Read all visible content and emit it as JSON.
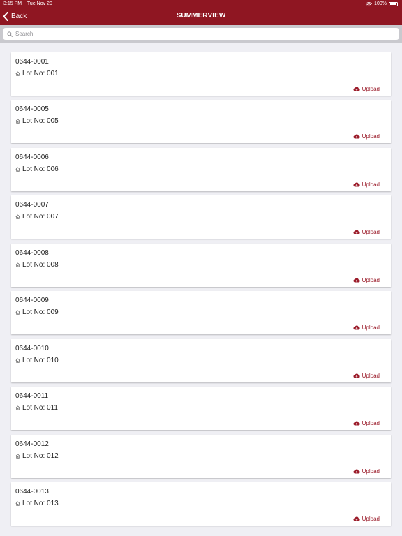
{
  "status_bar": {
    "time": "3:15 PM",
    "date": "Tue Nov 20",
    "battery": "100%",
    "icons": [
      "wifi-icon",
      "battery-icon"
    ]
  },
  "nav": {
    "back_label": "Back",
    "title": "SUMMERVIEW",
    "icons": [
      "chevron-left-icon"
    ]
  },
  "search": {
    "placeholder": "Search",
    "value": "",
    "icon": "search-icon"
  },
  "colors": {
    "brand": "#8f1622",
    "accent": "#9b1c2a",
    "search_bar_bg": "#c9c9ce",
    "list_bg": "#efeff4"
  },
  "items": [
    {
      "id": "0644-0001",
      "lot": "Lot No: 001",
      "action": "Upload"
    },
    {
      "id": "0644-0005",
      "lot": "Lot No: 005",
      "action": "Upload"
    },
    {
      "id": "0644-0006",
      "lot": "Lot No: 006",
      "action": "Upload"
    },
    {
      "id": "0644-0007",
      "lot": "Lot No: 007",
      "action": "Upload"
    },
    {
      "id": "0644-0008",
      "lot": "Lot No: 008",
      "action": "Upload"
    },
    {
      "id": "0644-0009",
      "lot": "Lot No: 009",
      "action": "Upload"
    },
    {
      "id": "0644-0010",
      "lot": "Lot No: 010",
      "action": "Upload"
    },
    {
      "id": "0644-0011",
      "lot": "Lot No: 011",
      "action": "Upload"
    },
    {
      "id": "0644-0012",
      "lot": "Lot No: 012",
      "action": "Upload"
    },
    {
      "id": "0644-0013",
      "lot": "Lot No: 013",
      "action": "Upload"
    }
  ],
  "item_icons": [
    "home-icon",
    "cloud-upload-icon"
  ]
}
